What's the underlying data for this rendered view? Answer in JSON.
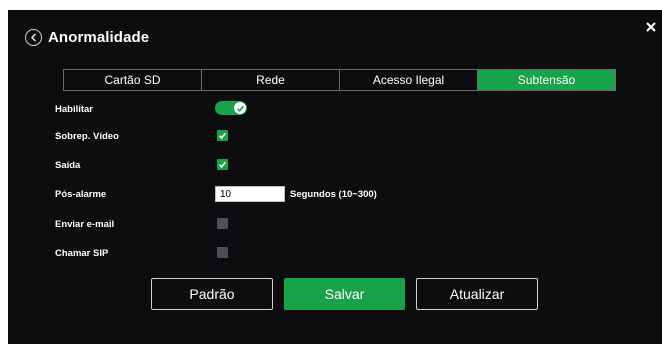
{
  "header": {
    "title": "Anormalidade"
  },
  "tabs": [
    {
      "label": "Cartão SD",
      "active": false
    },
    {
      "label": "Rede",
      "active": false
    },
    {
      "label": "Acesso Ilegal",
      "active": false
    },
    {
      "label": "Subtensão",
      "active": true
    }
  ],
  "form": {
    "habilitar": {
      "label": "Habilitar",
      "enabled": true
    },
    "sobrep_video": {
      "label": "Sobrep. Vídeo",
      "checked": true
    },
    "saida": {
      "label": "Saída",
      "checked": true
    },
    "pos_alarme": {
      "label": "Pós-alarme",
      "value": "10",
      "unit": "Segundos (10~300)"
    },
    "enviar_email": {
      "label": "Enviar e-mail",
      "checked": false
    },
    "chamar_sip": {
      "label": "Chamar SIP",
      "checked": false
    }
  },
  "buttons": {
    "default": "Padrão",
    "save": "Salvar",
    "refresh": "Atualizar"
  },
  "colors": {
    "accent": "#18a34a",
    "background": "#0d0d10",
    "unchecked": "#4a4f5a"
  }
}
